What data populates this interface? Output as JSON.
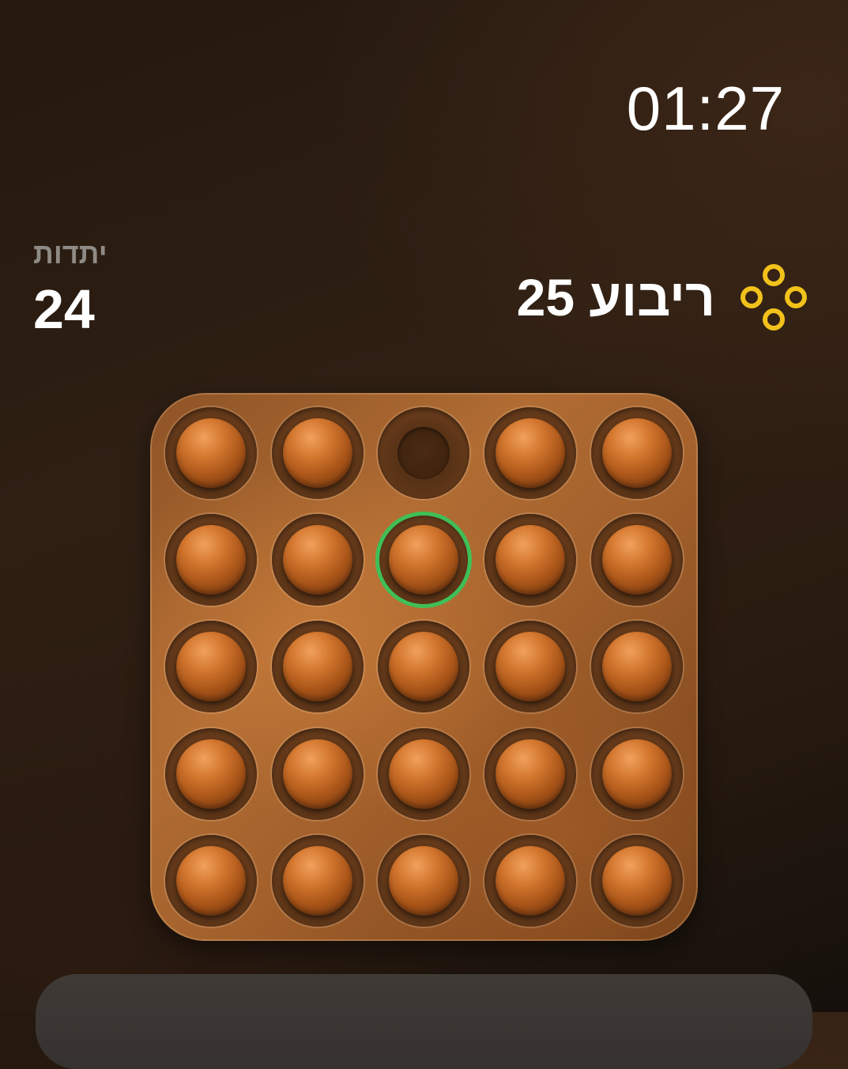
{
  "timer": {
    "display": "01:27"
  },
  "pegs_info": {
    "label": "יתדות",
    "count": "24"
  },
  "level": {
    "title": "ריבוע 25",
    "icon": "four-circles-icon",
    "icon_color": "#f2c21b"
  },
  "board": {
    "rows": 5,
    "cols": 5,
    "cells": [
      [
        "peg",
        "peg",
        "empty",
        "peg",
        "peg"
      ],
      [
        "peg",
        "peg",
        "peg",
        "peg",
        "peg"
      ],
      [
        "peg",
        "peg",
        "peg",
        "peg",
        "peg"
      ],
      [
        "peg",
        "peg",
        "peg",
        "peg",
        "peg"
      ],
      [
        "peg",
        "peg",
        "peg",
        "peg",
        "peg"
      ]
    ],
    "selected": {
      "row": 2,
      "col": 3
    },
    "selection_color": "#3fbf57"
  }
}
